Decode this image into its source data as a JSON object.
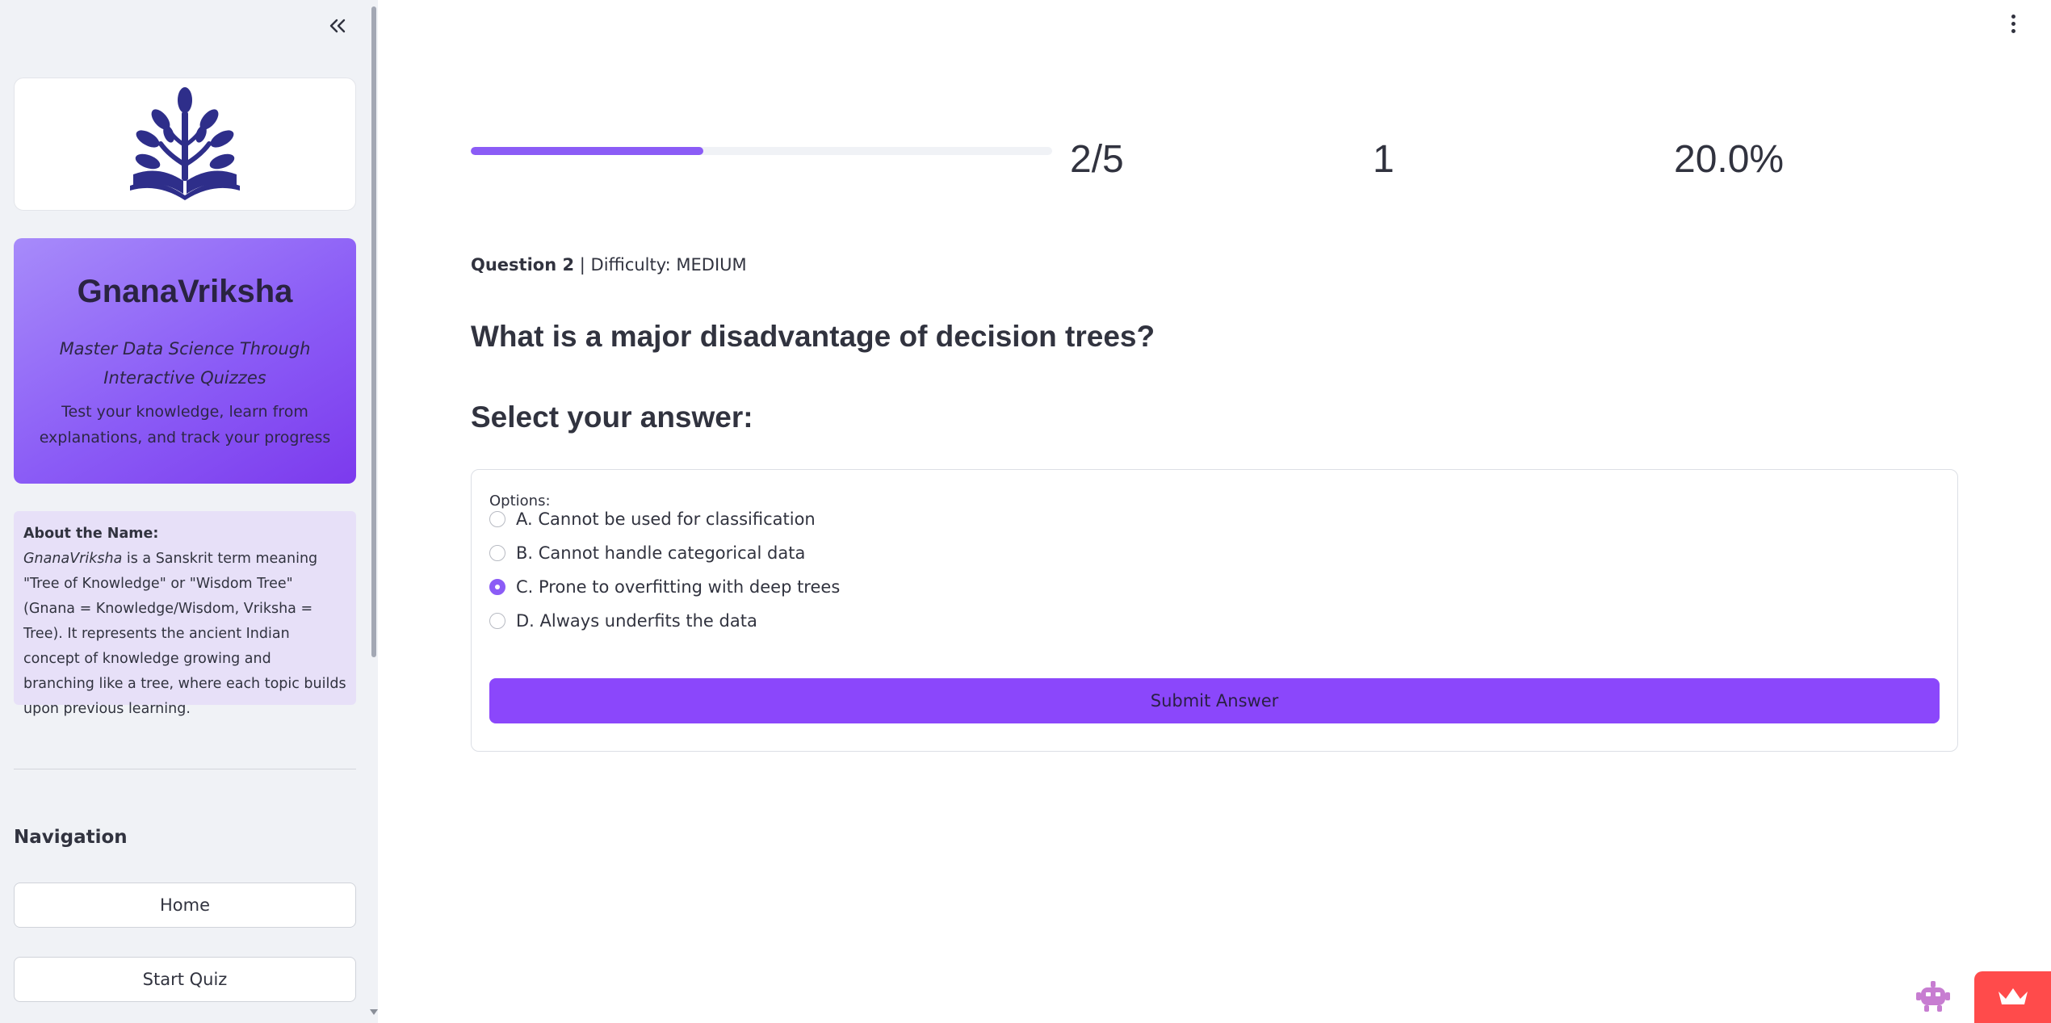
{
  "sidebar": {
    "brand": {
      "title": "GnanaVriksha",
      "tagline": "Master Data Science Through Interactive Quizzes",
      "subtitle": "Test your knowledge, learn from explanations, and track your progress"
    },
    "about": {
      "heading": "About the Name:",
      "name_term": "GnanaVriksha",
      "body": " is a Sanskrit term meaning \"Tree of Knowledge\" or \"Wisdom Tree\" (Gnana = Knowledge/Wisdom, Vriksha = Tree). It represents the ancient Indian concept of knowledge growing and branching like a tree, where each topic builds upon previous learning."
    },
    "navigation": {
      "title": "Navigation",
      "items": [
        {
          "label": "Home"
        },
        {
          "label": "Start Quiz"
        }
      ]
    }
  },
  "progress": {
    "fraction": 0.4,
    "metrics": {
      "question_progress": "2/5",
      "score": "1",
      "accuracy": "20.0%"
    }
  },
  "question": {
    "number_label": "Question 2",
    "difficulty_label": " | Difficulty: MEDIUM",
    "text": "What is a major disadvantage of decision trees?"
  },
  "answer_section": {
    "title": "Select your answer:",
    "options_label": "Options:",
    "options": [
      {
        "label": "A. Cannot be used for classification",
        "selected": false
      },
      {
        "label": "B. Cannot handle categorical data",
        "selected": false
      },
      {
        "label": "C. Prone to overfitting with deep trees",
        "selected": true
      },
      {
        "label": "D. Always underfits the data",
        "selected": false
      }
    ],
    "submit_label": "Submit Answer"
  },
  "colors": {
    "accent": "#8b5cf6",
    "submit": "#8b47fb",
    "badge": "#ff4b4b",
    "logo": "#2e2e8a"
  },
  "icons": {
    "collapse": "double-chevron-left-icon",
    "menu": "vertical-dots-icon",
    "logo": "tree-book-logo-icon",
    "bot": "robot-icon",
    "crown": "crown-icon"
  }
}
